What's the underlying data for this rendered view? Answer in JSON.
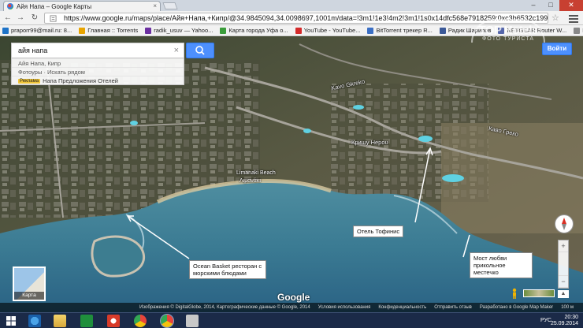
{
  "browser": {
    "tab_title": "Айя Напа – Google Карты",
    "url": "https://www.google.ru/maps/place/Айя+Напа,+Кипр/@34.9845094,34.0098697,1001m/data=!3m1!1e3!4m2!3m1!1s0x14dfc568e7918259:0xc3b6532c199ea1a40",
    "bookmarks": [
      {
        "label": "praporr99@mail.ru: 8...",
        "color": "#1e73c8"
      },
      {
        "label": "Главная :: Torrents",
        "color": "#e8a400"
      },
      {
        "label": "radik_usuv — Yahoo...",
        "color": "#6b2fa0"
      },
      {
        "label": "Карта города Уфа о...",
        "color": "#3b9d3b"
      },
      {
        "label": "YouTube - YouTube...",
        "color": "#d42a2a"
      },
      {
        "label": "BitTorrent трекер R...",
        "color": "#3b6fc4"
      },
      {
        "label": "Радик Шарипов",
        "color": "#3b5998"
      },
      {
        "label": "NETGEAR Router W...",
        "color": "#5566aa"
      },
      {
        "label": "Metallica Fan обо...",
        "color": "#888888"
      }
    ]
  },
  "map": {
    "search": {
      "value": "айя напа",
      "clear_icon": "×"
    },
    "suggestions": [
      {
        "text": "Айя Напа, Кипр"
      },
      {
        "text": "Фотоуры · Искать рядом"
      },
      {
        "badge": "Реклама",
        "text": "Напа Предложения Отелей"
      }
    ],
    "signin_label": "Войти",
    "watermark": {
      "brand": "TOP Hotels",
      "sub": "ФОТО ТУРИСТА"
    },
    "labels": [
      {
        "text": "Kavo Gkreko",
        "kind": "road"
      },
      {
        "text": "Каво Греко",
        "kind": "road"
      },
      {
        "text": "Кришу Нерου",
        "kind": "road"
      },
      {
        "text": "Limanaki Beach",
        "kind": "place"
      },
      {
        "text": "Λιμανάκι",
        "kind": "place"
      }
    ],
    "annotations": {
      "ocean": "Ocean Basket ресторан с морскими блюдами",
      "hotel": "Отель Тофинис",
      "bridge": "Мост любви прикольное местечко"
    },
    "google_logo": "Google",
    "minimap_label": "Карта",
    "zoom_plus": "+",
    "zoom_minus": "−",
    "footer": [
      "Изображения © DigitalGlobe, 2014, Картографические данные © Google, 2014",
      "Условия использования",
      "Конфиденциальность",
      "Отправить отзыв",
      "Разработано в Google Map Maker",
      "100 м"
    ]
  },
  "taskbar": {
    "language": "РУС",
    "time": "20:30",
    "date": "25.09.2014"
  }
}
